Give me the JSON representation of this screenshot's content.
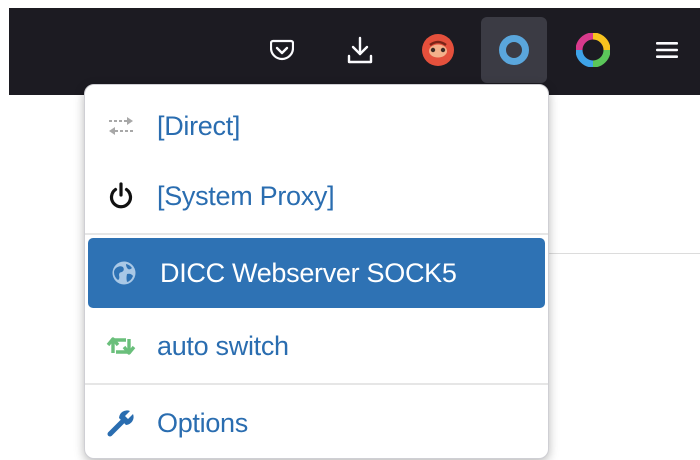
{
  "toolbar": {
    "buttons": [
      {
        "name": "pocket",
        "icon": "pocket-icon",
        "color": "#fbfbfe"
      },
      {
        "name": "downloads",
        "icon": "download-icon",
        "color": "#fbfbfe"
      },
      {
        "name": "extension",
        "icon": "red-extension-icon",
        "color": "#e4503c"
      },
      {
        "name": "proxy-switcher",
        "icon": "proxy-ring-icon",
        "color": "#5aa6dc",
        "active": true
      },
      {
        "name": "color-extension",
        "icon": "rainbow-ring-icon"
      },
      {
        "name": "menu",
        "icon": "hamburger-menu-icon",
        "color": "#fbfbfe"
      }
    ]
  },
  "popup": {
    "items": [
      {
        "label": "[Direct]",
        "icon": "transfer-arrows-icon",
        "icon_color": "#a8a8a8"
      },
      {
        "label": "[System Proxy]",
        "icon": "power-icon",
        "icon_color": "#111111"
      },
      {
        "label": "DICC Webserver SOCK5",
        "icon": "globe-icon",
        "selected": true
      },
      {
        "label": "auto switch",
        "icon": "retweet-icon",
        "icon_color": "#6abf7b"
      },
      {
        "label": "Options",
        "icon": "wrench-icon",
        "icon_color": "#2a6db0"
      }
    ],
    "colors": {
      "link": "#2a6db0",
      "selected_bg": "#2e72b4",
      "selected_text": "#ffffff"
    }
  }
}
